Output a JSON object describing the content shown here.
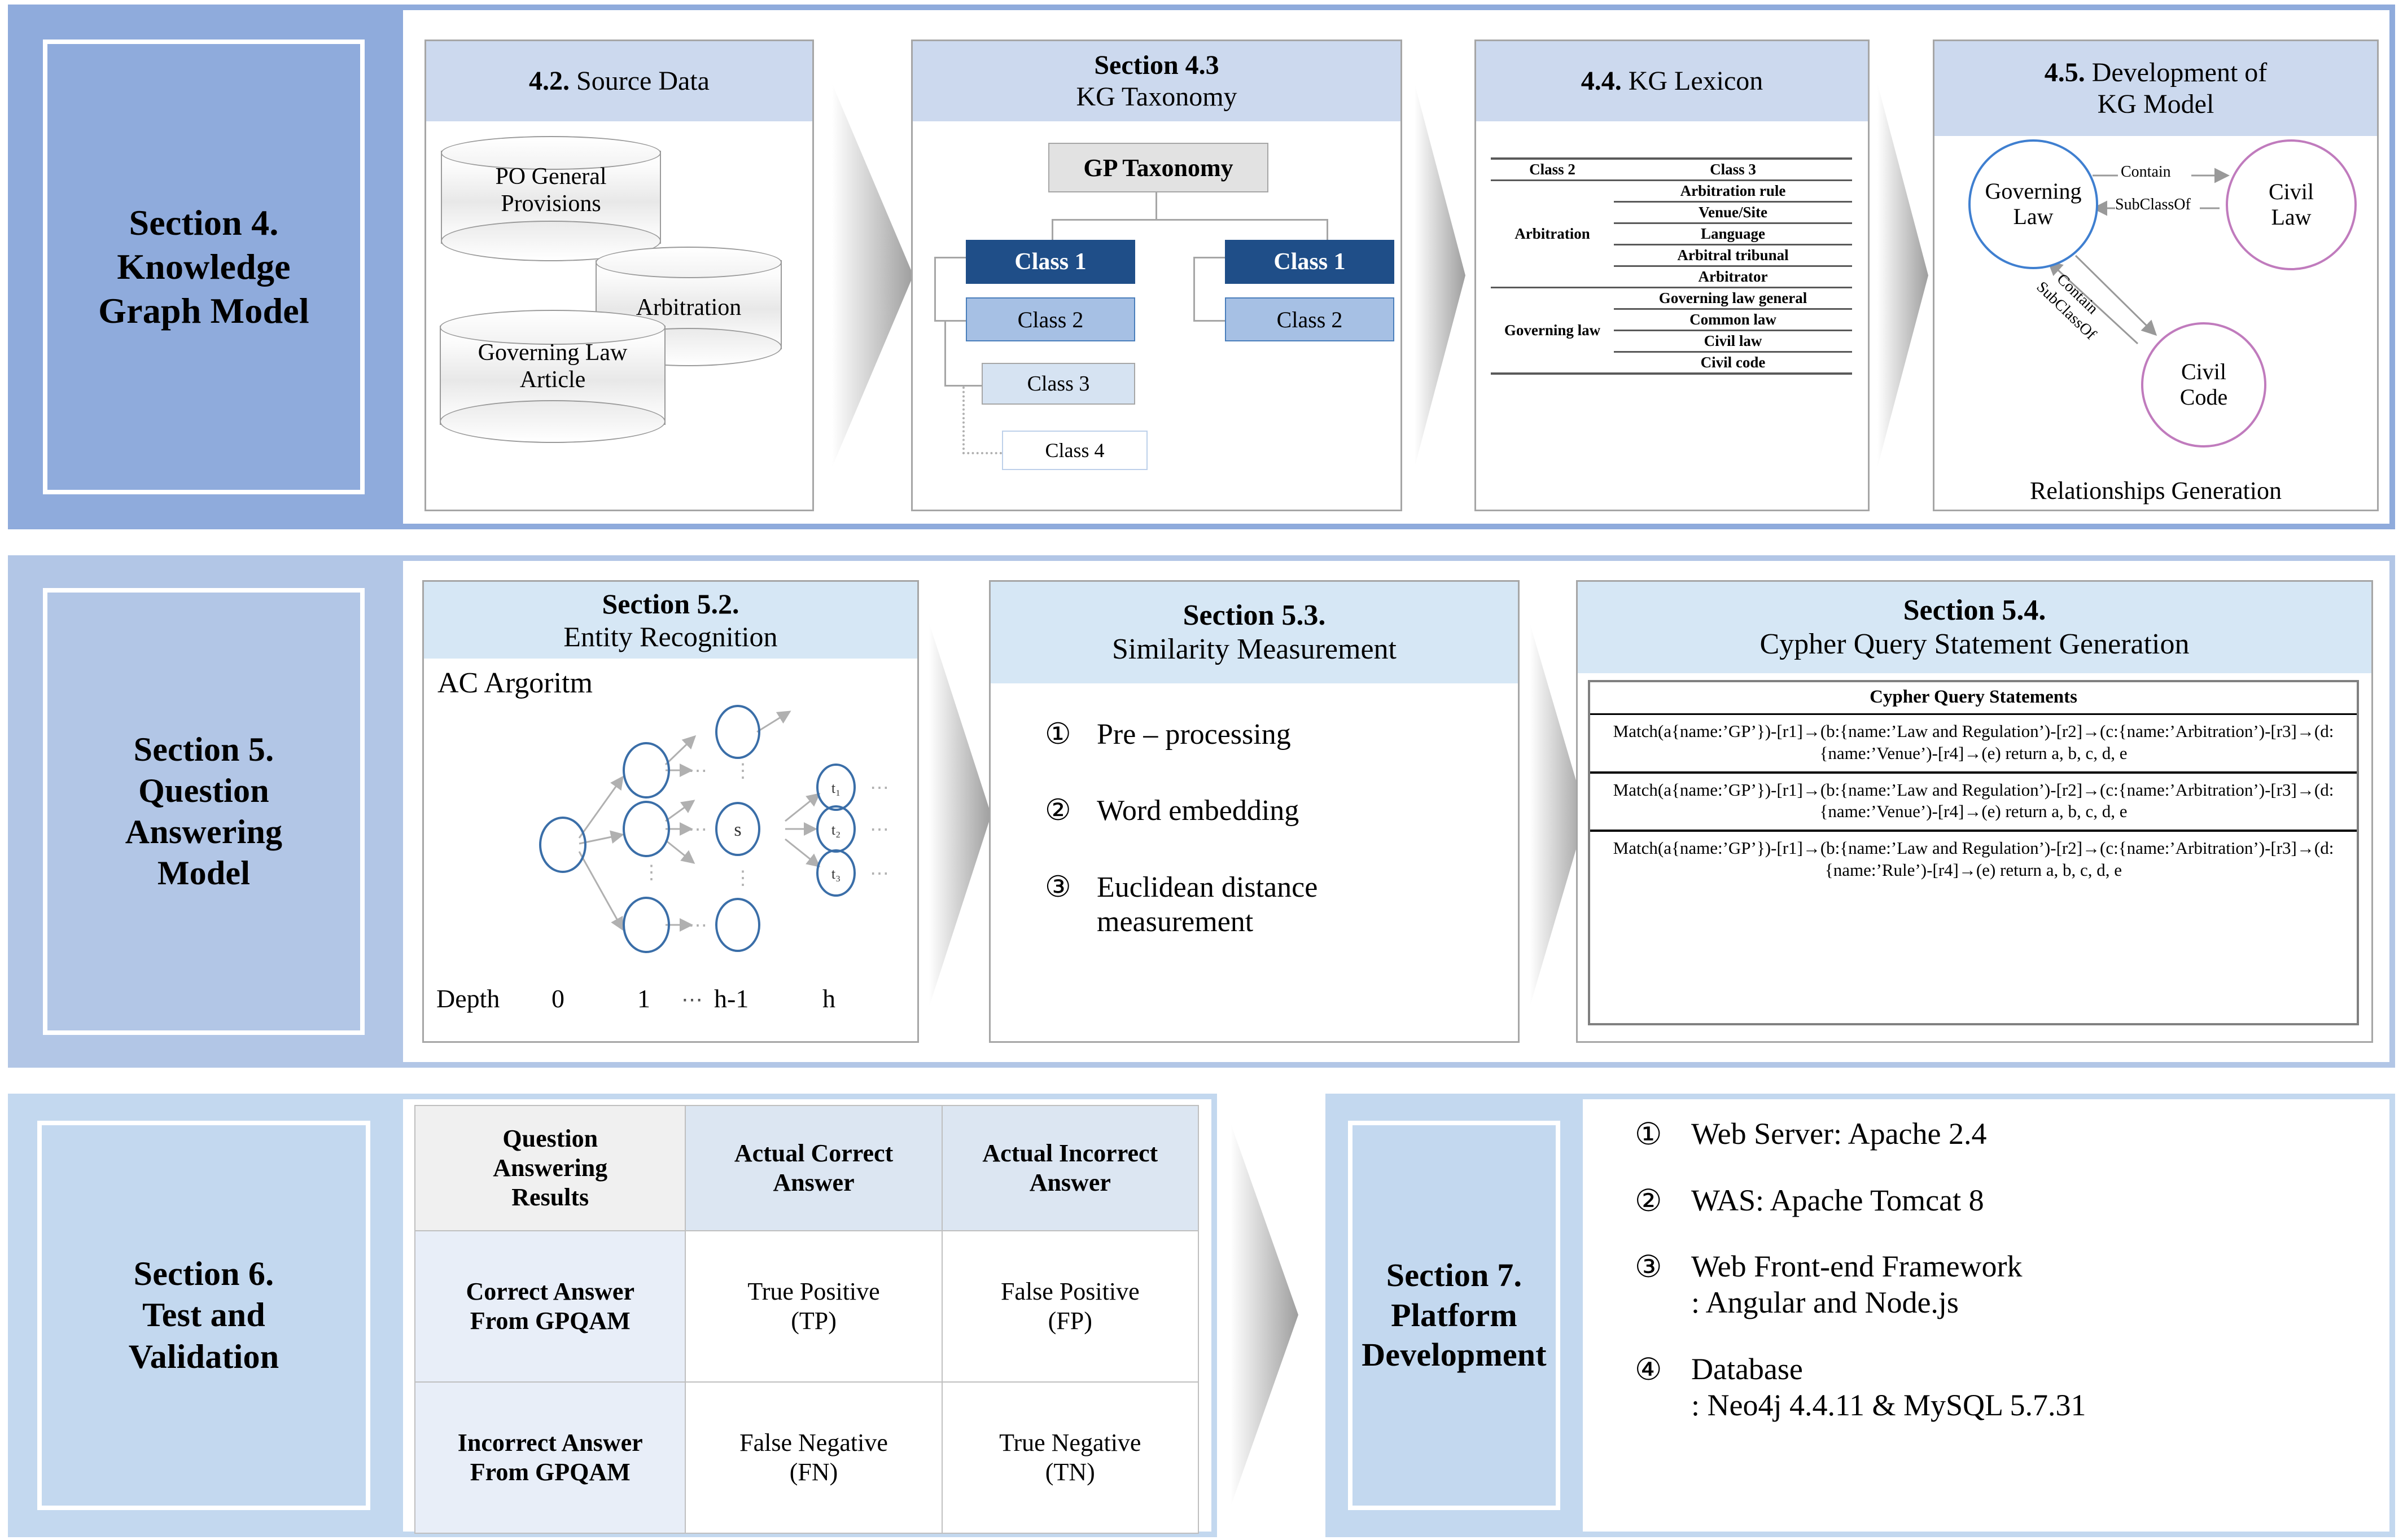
{
  "colors": {
    "row1_sidebar": "#8fabdc",
    "row2_sidebar": "#b2c6e6",
    "row3_sidebar": "#c3d8ef",
    "panel_header": "#ccd9ee",
    "panel_border": "#a6a6a6",
    "class1": "#1f4e88",
    "class2": "#a6c0e4",
    "class3": "#d6e3f2",
    "class4": "#ffffff",
    "node_blue": "#3f7fd0",
    "node_pink": "#c07bbd",
    "arrow_gray": "#b5b5b5"
  },
  "rows": [
    {
      "section_label": "Section 4.\nKnowledge\nGraph Model",
      "section_label_lines": [
        "Section 4.",
        "Knowledge",
        "Graph Model"
      ]
    },
    {
      "section_label_lines": [
        "Section 5.",
        "Question",
        "Answering",
        "Model"
      ]
    },
    {
      "section_label_lines": [
        "Section 6.",
        "Test and",
        "Validation"
      ]
    }
  ],
  "row1": {
    "sidebar": {
      "lines": [
        "Section 4.",
        "Knowledge",
        "Graph Model"
      ]
    },
    "panel_source": {
      "header_bold": "4.2.",
      "header_rest": " Source Data",
      "cylinders": [
        {
          "label_lines": [
            "PO General",
            "Provisions"
          ]
        },
        {
          "label_lines": [
            "Arbitration"
          ]
        },
        {
          "label_lines": [
            "Governing Law",
            "Article"
          ]
        }
      ]
    },
    "panel_taxonomy": {
      "header_line1": "Section 4.3",
      "header_line2": "KG Taxonomy",
      "root": "GP Taxonomy",
      "left_branch": [
        "Class 1",
        "Class 2",
        "Class 3",
        "Class 4"
      ],
      "right_branch": [
        "Class 1",
        "Class 2"
      ]
    },
    "panel_lexicon": {
      "header_bold": "4.4.",
      "header_rest": " KG  Lexicon",
      "columns": [
        "Class 2",
        "Class 3"
      ],
      "groups": [
        {
          "class2": "Arbitration",
          "class3": [
            "Arbitration rule",
            "Venue/Site",
            "Language",
            "Arbitral tribunal",
            "Arbitrator"
          ]
        },
        {
          "class2": "Governing law",
          "class3": [
            "Governing law general",
            "Common law",
            "Civil law",
            "Civil code"
          ]
        }
      ]
    },
    "panel_kgmodel": {
      "header_bold": "4.5.",
      "header_rest": " Development of",
      "header_line2": "KG Model",
      "nodes": [
        {
          "id": "governing-law",
          "lines": [
            "Governing",
            "Law"
          ],
          "color": "blue"
        },
        {
          "id": "civil-law",
          "lines": [
            "Civil",
            "Law"
          ],
          "color": "pink"
        },
        {
          "id": "civil-code",
          "lines": [
            "Civil",
            "Code"
          ],
          "color": "pink"
        }
      ],
      "edges": [
        {
          "label": "Contain",
          "from": "governing-law",
          "to": "civil-law"
        },
        {
          "label": "SubClassOf",
          "from": "civil-law",
          "to": "governing-law"
        },
        {
          "label": "Contain",
          "from": "governing-law",
          "to": "civil-code"
        },
        {
          "label": "SubClassOf",
          "from": "civil-code",
          "to": "governing-law"
        }
      ],
      "caption": "Relationships Generation"
    }
  },
  "row2": {
    "sidebar": {
      "lines": [
        "Section 5.",
        "Question",
        "Answering",
        "Model"
      ]
    },
    "panel_entity": {
      "header_line1": "Section 5.2.",
      "header_line2": "Entity Recognition",
      "algorithm_title": "AC Argoritm",
      "trie_nodes": [
        "s",
        "t₁",
        "t₂",
        "t₃"
      ],
      "depth_label": "Depth",
      "depth_ticks": [
        "0",
        "1",
        "⋯",
        "h-1",
        "h"
      ]
    },
    "panel_similarity": {
      "header_line1": "Section 5.3.",
      "header_line2": "Similarity Measurement",
      "items": [
        {
          "num": "①",
          "text": "Pre – processing"
        },
        {
          "num": "②",
          "text": "Word embedding"
        },
        {
          "num": "③",
          "text": "Euclidean distance measurement"
        }
      ]
    },
    "panel_cypher": {
      "header_line1": "Section 5.4.",
      "header_line2": "Cypher Query Statement Generation",
      "table_title": "Cypher Query Statements",
      "statements": [
        "Match(a{name:’GP’})-[r1]→(b:{name:’Law and Regulation’)-[r2]→(c:{name:’Arbitration’)-[r3]→(d:{name:’Venue’)-[r4]→(e) return a, b, c, d, e",
        "Match(a{name:’GP’})-[r1]→(b:{name:’Law and Regulation’)-[r2]→(c:{name:’Arbitration’)-[r3]→(d:{name:’Venue’)-[r4]→(e) return a, b, c, d, e",
        "Match(a{name:’GP’})-[r1]→(b:{name:’Law and Regulation’)-[r2]→(c:{name:’Arbitration’)-[r3]→(d:{name:’Rule’)-[r4]→(e) return a, b, c, d, e"
      ]
    }
  },
  "row3": {
    "sidebar": {
      "lines": [
        "Section 6.",
        "Test and",
        "Validation"
      ]
    },
    "confusion_matrix": {
      "corner_lines": [
        "Question",
        "Answering",
        "Results"
      ],
      "col_headers": [
        {
          "lines": [
            "Actual Correct",
            "Answer"
          ]
        },
        {
          "lines": [
            "Actual Incorrect",
            "Answer"
          ]
        }
      ],
      "rows": [
        {
          "header_lines": [
            "Correct Answer",
            "From GPQAM"
          ],
          "cells": [
            {
              "lines": [
                "True Positive",
                "(TP)"
              ]
            },
            {
              "lines": [
                "False Positive",
                "(FP)"
              ]
            }
          ]
        },
        {
          "header_lines": [
            "Incorrect Answer",
            "From GPQAM"
          ],
          "cells": [
            {
              "lines": [
                "False Negative",
                "(FN)"
              ]
            },
            {
              "lines": [
                "True Negative",
                "(TN)"
              ]
            }
          ]
        }
      ]
    },
    "sidebar7": {
      "lines": [
        "Section 7.",
        "Platform",
        "Development"
      ]
    },
    "platform_items": [
      {
        "num": "①",
        "lines": [
          "Web Server: Apache 2.4"
        ]
      },
      {
        "num": "②",
        "lines": [
          "WAS: Apache Tomcat 8"
        ]
      },
      {
        "num": "③",
        "lines": [
          "Web Front-end Framework",
          ": Angular and Node.js"
        ]
      },
      {
        "num": "④",
        "lines": [
          "Database",
          ": Neo4j 4.4.11 & MySQL 5.7.31"
        ]
      }
    ]
  }
}
